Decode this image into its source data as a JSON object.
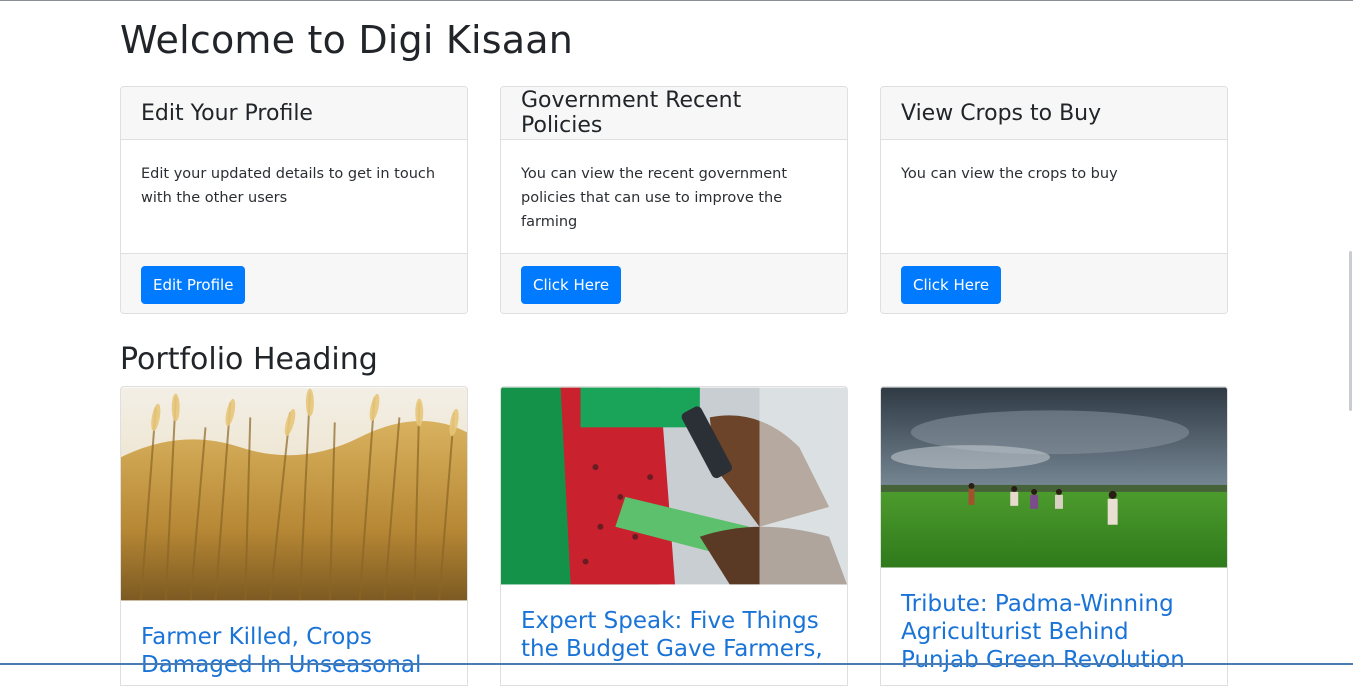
{
  "page": {
    "title": "Welcome to Digi Kisaan"
  },
  "cards": [
    {
      "header": "Edit Your Profile",
      "body": "Edit your updated details to get in touch with the other users",
      "button": "Edit Profile"
    },
    {
      "header": "Government Recent Policies",
      "body": "You can view the recent government policies that can use to improve the farming",
      "button": "Click Here"
    },
    {
      "header": "View Crops to Buy",
      "body": "You can view the crops to buy",
      "button": "Click Here"
    }
  ],
  "portfolio": {
    "heading": "Portfolio Heading",
    "items": [
      {
        "title": "Farmer Killed, Crops Damaged In Unseasonal",
        "image": "wheat-field-photo"
      },
      {
        "title": "Expert Speak: Five Things the Budget Gave Farmers,",
        "image": "farmer-holding-phone-photo"
      },
      {
        "title": "Tribute: Padma-Winning Agriculturist Behind Punjab Green Revolution",
        "image": "green-field-workers-photo"
      }
    ]
  },
  "colors": {
    "primary": "#007bff",
    "link": "#1a73d6",
    "card_header_bg": "#f7f7f7"
  }
}
